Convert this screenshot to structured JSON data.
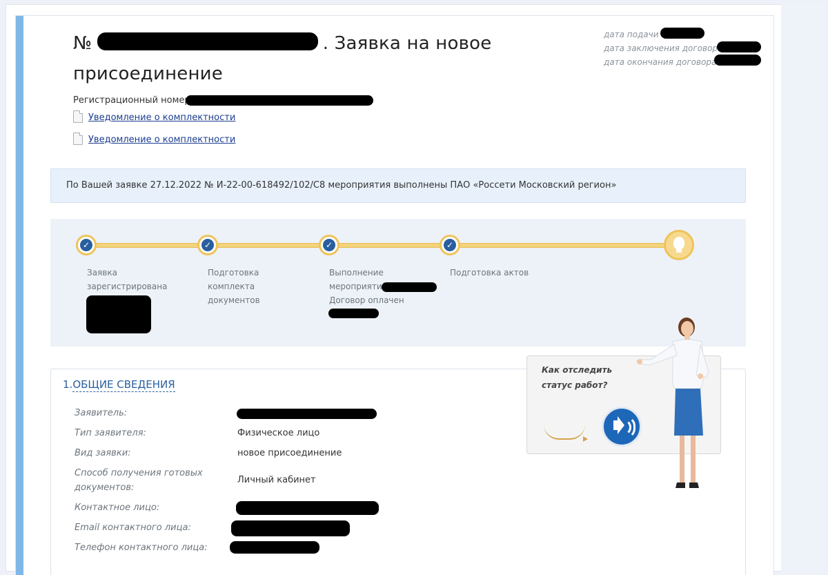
{
  "application": {
    "title_prefix": "№",
    "title_suffix": ". Заявка на новое присоединение",
    "dates": {
      "submit_label": "дата подачи",
      "contract_label": "дата заключения договора",
      "contract_end_label": "дата окончания договора"
    },
    "reg_number_label": "Регистрационный номер",
    "documents": [
      {
        "label": "Уведомление о комплектности"
      },
      {
        "label": "Уведомление о комплектности"
      }
    ]
  },
  "notice": {
    "text": "По Вашей заявке 27.12.2022 № И-22-00-618492/102/С8 мероприятия выполнены ПАО «Россети Московский регион»"
  },
  "progress": {
    "steps": [
      {
        "label_line1": "Заявка",
        "label_line2": "зарегистрирована",
        "done": true
      },
      {
        "label_line1": "Подготовка",
        "label_line2": "комплекта",
        "label_line3": "документов",
        "done": true
      },
      {
        "label_line1": "Выполнение",
        "label_line2": "мероприятий",
        "label_line3": "Договор оплачен",
        "done": true
      },
      {
        "label_line1": "Подготовка актов",
        "done": true
      }
    ],
    "final_icon": "lightbulb-icon",
    "accent_color": "#efc35a",
    "done_color": "#295f9f"
  },
  "general": {
    "section_number": "1.",
    "section_title": "ОБЩИЕ СВЕДЕНИЯ",
    "rows": [
      {
        "label": "Заявитель:",
        "value": ""
      },
      {
        "label": "Тип заявителя:",
        "value": "Физическое лицо"
      },
      {
        "label": "Вид заявки:",
        "value": "новое присоединение"
      },
      {
        "label_line1": "Способ получения готовых",
        "label_line2": "документов:",
        "value": "Личный кабинет"
      },
      {
        "label": "Контактное лицо:",
        "value": ""
      },
      {
        "label": "Email контактного лица:",
        "value": ""
      },
      {
        "label": "Телефон контактного лица:",
        "value": ""
      }
    ]
  },
  "help": {
    "line1": "Как отследить",
    "line2": "статус работ?",
    "button_icon": "speaker-icon"
  }
}
